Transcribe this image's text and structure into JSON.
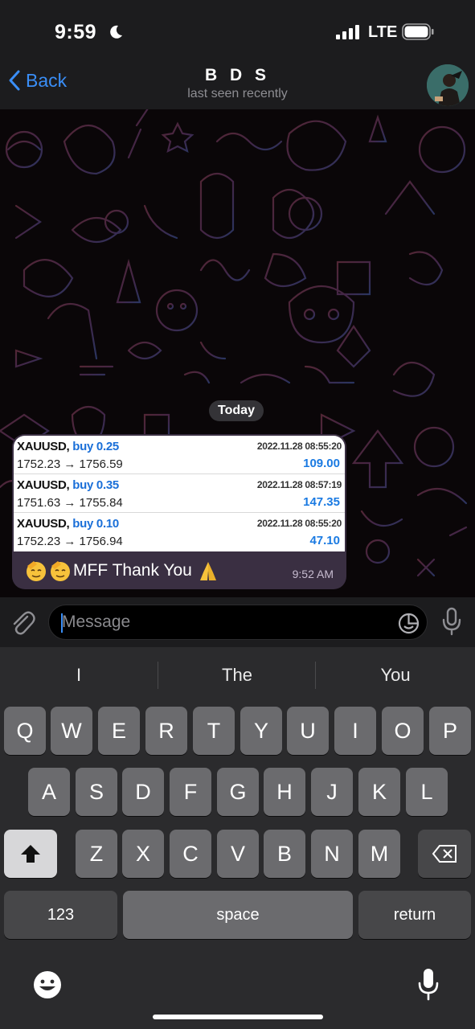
{
  "status_bar": {
    "time": "9:59",
    "network": "LTE"
  },
  "header": {
    "back_label": "Back",
    "title": "B D S",
    "subtitle": "last seen recently"
  },
  "chat": {
    "date_label": "Today",
    "message": {
      "trades": [
        {
          "symbol": "XAUUSD,",
          "side": "buy 0.25",
          "datetime": "2022.11.28 08:55:20",
          "prices": "1752.23 → 1756.59",
          "profit": "109.00"
        },
        {
          "symbol": "XAUUSD,",
          "side": "buy 0.35",
          "datetime": "2022.11.28 08:57:19",
          "prices": "1751.63 → 1755.84",
          "profit": "147.35"
        },
        {
          "symbol": "XAUUSD,",
          "side": "buy 0.10",
          "datetime": "2022.11.28 08:55:20",
          "prices": "1752.23 → 1756.94",
          "profit": "47.10"
        }
      ],
      "text": "MFF Thank You",
      "time": "9:52 AM"
    }
  },
  "input": {
    "placeholder": "Message"
  },
  "keyboard": {
    "suggestions": [
      "I",
      "The",
      "You"
    ],
    "row1": [
      "Q",
      "W",
      "E",
      "R",
      "T",
      "Y",
      "U",
      "I",
      "O",
      "P"
    ],
    "row2": [
      "A",
      "S",
      "D",
      "F",
      "G",
      "H",
      "J",
      "K",
      "L"
    ],
    "row3": [
      "Z",
      "X",
      "C",
      "V",
      "B",
      "N",
      "M"
    ],
    "numbers_label": "123",
    "space_label": "space",
    "return_label": "return"
  },
  "colors": {
    "accent": "#3a8ef7",
    "bubble": "#3a2f42",
    "profit": "#1a7ae2",
    "buy": "#1a6fd8"
  }
}
